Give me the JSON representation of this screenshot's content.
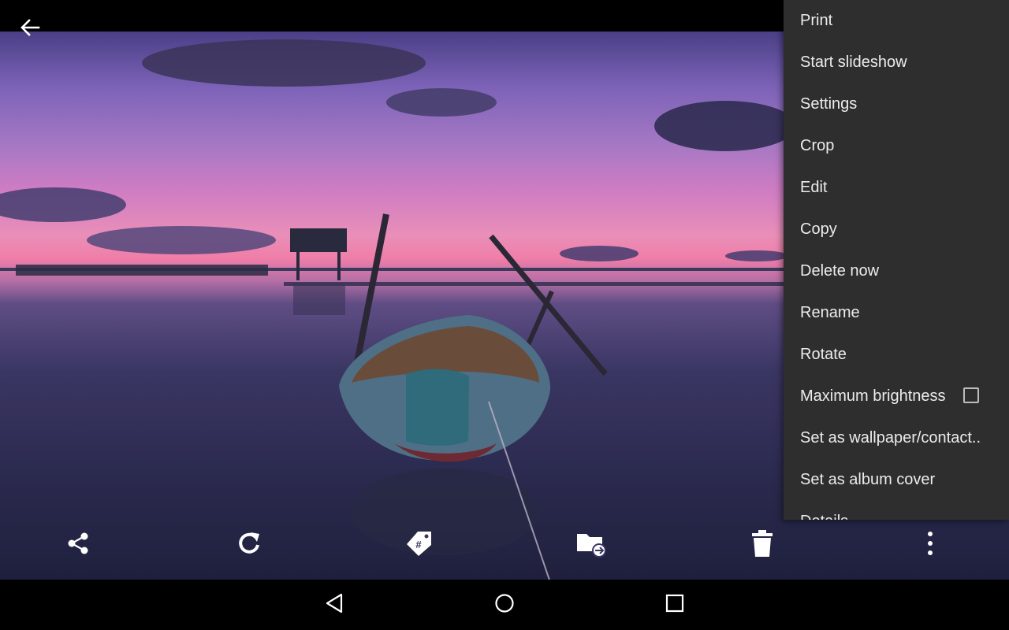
{
  "toolbar": {
    "icons": [
      "share-icon",
      "rotate-icon",
      "tag-icon",
      "move-to-folder-icon",
      "delete-icon",
      "more-vert-icon"
    ]
  },
  "menu": {
    "items": [
      {
        "label": "Print"
      },
      {
        "label": "Start slideshow"
      },
      {
        "label": "Settings"
      },
      {
        "label": "Crop"
      },
      {
        "label": "Edit"
      },
      {
        "label": "Copy"
      },
      {
        "label": "Delete now"
      },
      {
        "label": "Rename"
      },
      {
        "label": "Rotate"
      },
      {
        "label": "Maximum brightness",
        "checked": false
      },
      {
        "label": "Set as wallpaper/contact.."
      },
      {
        "label": "Set as album cover"
      },
      {
        "label": "Details"
      }
    ]
  },
  "colors": {
    "menu_background": "#2e2e2e",
    "menu_text": "#ececec",
    "icon": "#ffffff"
  }
}
